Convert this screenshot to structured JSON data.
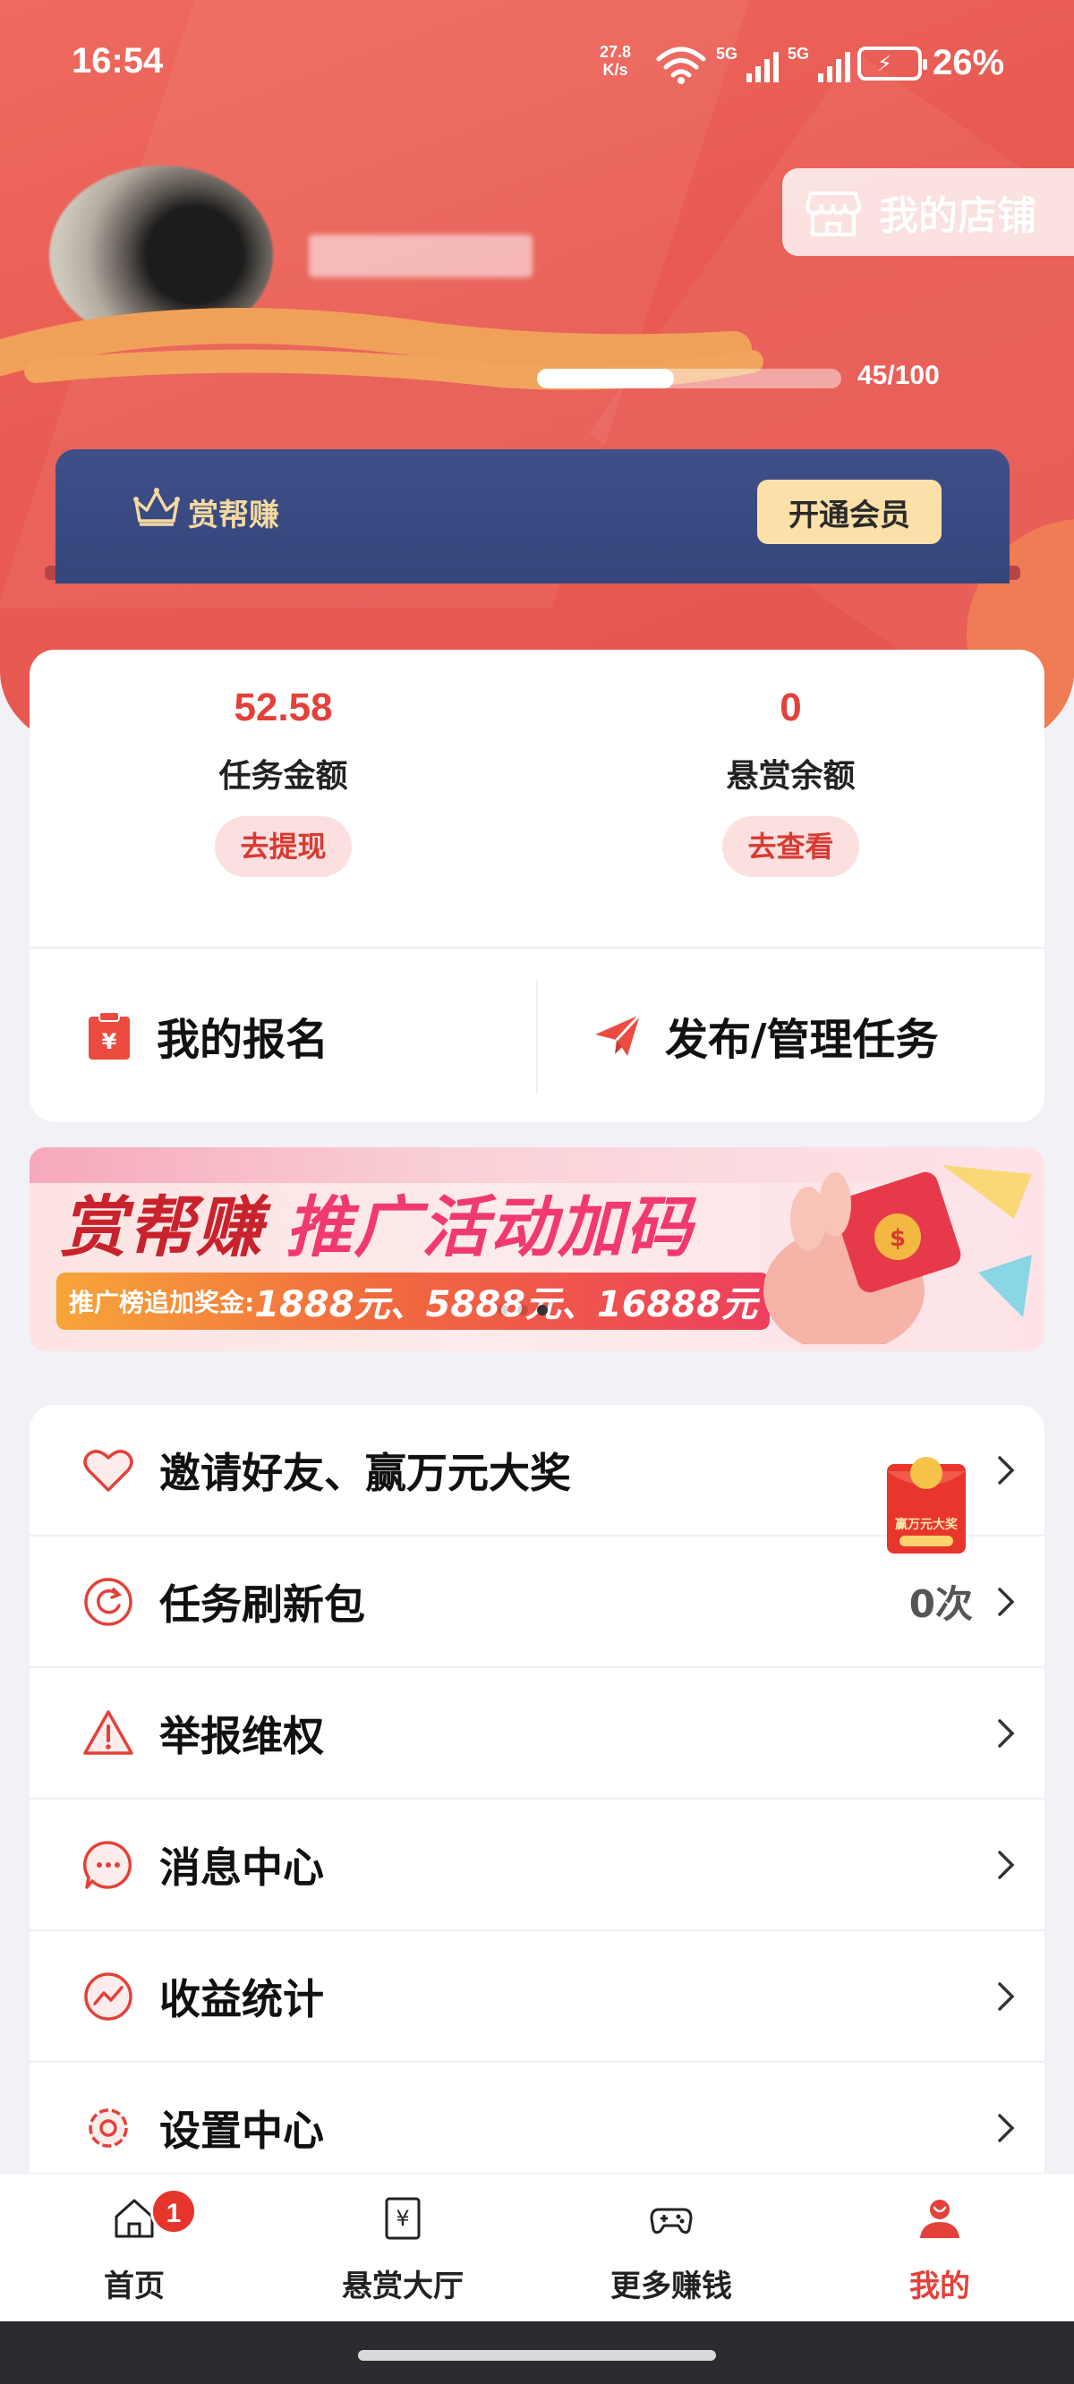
{
  "status_bar": {
    "time": "16:54",
    "net_speed_value": "27.8",
    "net_speed_unit": "K/s",
    "sim1": "5G",
    "sim2": "5G",
    "battery": "26%"
  },
  "profile": {
    "level_progress_text": "45/100",
    "level_progress_fraction": 0.45
  },
  "shop_button": {
    "label": "我的店铺"
  },
  "vip": {
    "name": "赏帮赚",
    "button": "开通会员"
  },
  "stats": {
    "task_amount": {
      "value": "52.58",
      "label": "任务金额",
      "button": "去提现"
    },
    "reward_balance": {
      "value": "0",
      "label": "悬赏余额",
      "button": "去查看"
    }
  },
  "actions": {
    "my_signup": "我的报名",
    "publish_manage": "发布/管理任务"
  },
  "banner": {
    "title_part1": "赏帮赚",
    "title_part2": "推广活动加码",
    "sub_prefix": "推广榜追加奖金:",
    "sub_amounts": "1888元、5888元、16888元",
    "red_packet_text": "赢万元大奖"
  },
  "menu": {
    "items": [
      {
        "label": "邀请好友、赢万元大奖",
        "icon": "heart-icon"
      },
      {
        "label": "任务刷新包",
        "value": "0次",
        "icon": "refresh-icon"
      },
      {
        "label": "举报维权",
        "icon": "warning-icon"
      },
      {
        "label": "消息中心",
        "icon": "message-icon"
      },
      {
        "label": "收益统计",
        "icon": "chart-icon"
      },
      {
        "label": "设置中心",
        "icon": "gear-icon"
      }
    ]
  },
  "tabbar": {
    "items": [
      {
        "label": "首页",
        "icon": "home-icon",
        "badge": "1"
      },
      {
        "label": "悬赏大厅",
        "icon": "yuan-doc-icon"
      },
      {
        "label": "更多赚钱",
        "icon": "gamepad-icon"
      },
      {
        "label": "我的",
        "icon": "user-icon",
        "active": true
      }
    ]
  },
  "colors": {
    "accent": "#e3413a",
    "header": "#e85a52",
    "vip_card": "#3a4a82",
    "vip_button": "#fbe0a9"
  }
}
